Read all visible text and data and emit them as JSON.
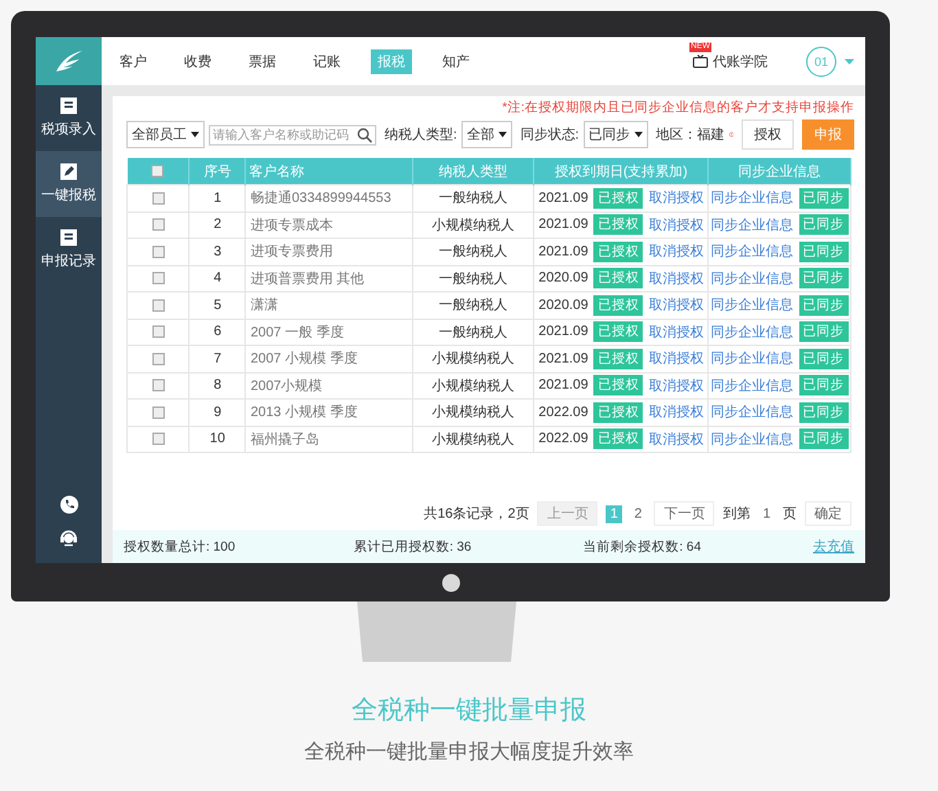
{
  "nav": {
    "tabs": [
      {
        "label": "客户",
        "selected": false
      },
      {
        "label": "收费",
        "selected": false
      },
      {
        "label": "票据",
        "selected": false
      },
      {
        "label": "记账",
        "selected": false
      },
      {
        "label": "报税",
        "selected": true
      },
      {
        "label": "知产",
        "selected": false
      }
    ],
    "academy": {
      "badge": "NEW",
      "label": "代账学院"
    },
    "user": "01"
  },
  "sidebar": {
    "items": [
      {
        "label": "税项录入",
        "selected": false
      },
      {
        "label": "一键报税",
        "selected": true
      },
      {
        "label": "申报记录",
        "selected": false
      }
    ]
  },
  "notice": "*注:在授权期限内且已同步企业信息的客户才支持申报操作",
  "filters": {
    "staff": "全部员工",
    "search": {
      "placeholder": "请输入客户名称或助记码"
    },
    "taxpayer_type": {
      "label": "纳税人类型:",
      "value": "全部"
    },
    "sync_status": {
      "label": "同步状态:",
      "value": "已同步"
    },
    "region": {
      "label": "地区：",
      "value": "福建"
    },
    "buttons": [
      {
        "label": "授权",
        "kind": "default"
      },
      {
        "label": "申报",
        "kind": "primary"
      }
    ]
  },
  "table": {
    "header_checked": false,
    "columns": [
      "序号",
      "客户名称",
      "纳税人类型",
      "授权到期日(支持累加)",
      "同步企业信息"
    ],
    "rows": [
      {
        "checked": false,
        "index": "1",
        "name": "畅捷通0334899944553",
        "type": "一般纳税人",
        "expiry": "2021.09",
        "auth_badge": "已授权",
        "cancel": "取消授权",
        "sync_link": "同步企业信息",
        "sync_badge": "已同步"
      },
      {
        "checked": false,
        "index": "2",
        "name": "进项专票成本",
        "type": "小规模纳税人",
        "expiry": "2021.09",
        "auth_badge": "已授权",
        "cancel": "取消授权",
        "sync_link": "同步企业信息",
        "sync_badge": "已同步"
      },
      {
        "checked": false,
        "index": "3",
        "name": "进项专票费用",
        "type": "一般纳税人",
        "expiry": "2021.09",
        "auth_badge": "已授权",
        "cancel": "取消授权",
        "sync_link": "同步企业信息",
        "sync_badge": "已同步"
      },
      {
        "checked": false,
        "index": "4",
        "name": "进项普票费用 其他",
        "type": "一般纳税人",
        "expiry": "2020.09",
        "auth_badge": "已授权",
        "cancel": "取消授权",
        "sync_link": "同步企业信息",
        "sync_badge": "已同步"
      },
      {
        "checked": false,
        "index": "5",
        "name": "潇潇",
        "type": "一般纳税人",
        "expiry": "2020.09",
        "auth_badge": "已授权",
        "cancel": "取消授权",
        "sync_link": "同步企业信息",
        "sync_badge": "已同步"
      },
      {
        "checked": false,
        "index": "6",
        "name": "2007 一般 季度",
        "type": "一般纳税人",
        "expiry": "2021.09",
        "auth_badge": "已授权",
        "cancel": "取消授权",
        "sync_link": "同步企业信息",
        "sync_badge": "已同步"
      },
      {
        "checked": false,
        "index": "7",
        "name": "2007 小规模 季度",
        "type": "小规模纳税人",
        "expiry": "2021.09",
        "auth_badge": "已授权",
        "cancel": "取消授权",
        "sync_link": "同步企业信息",
        "sync_badge": "已同步"
      },
      {
        "checked": false,
        "index": "8",
        "name": "2007小规模",
        "type": "小规模纳税人",
        "expiry": "2021.09",
        "auth_badge": "已授权",
        "cancel": "取消授权",
        "sync_link": "同步企业信息",
        "sync_badge": "已同步"
      },
      {
        "checked": false,
        "index": "9",
        "name": "2013 小规模 季度",
        "type": "小规模纳税人",
        "expiry": "2022.09",
        "auth_badge": "已授权",
        "cancel": "取消授权",
        "sync_link": "同步企业信息",
        "sync_badge": "已同步"
      },
      {
        "checked": false,
        "index": "10",
        "name": "福州撬子岛",
        "type": "小规模纳税人",
        "expiry": "2022.09",
        "auth_badge": "已授权",
        "cancel": "取消授权",
        "sync_link": "同步企业信息",
        "sync_badge": "已同步"
      }
    ]
  },
  "pagination": {
    "summary": "共16条记录，2页",
    "prev": {
      "label": "上一页",
      "disabled": true
    },
    "pages": [
      {
        "label": "1",
        "selected": true
      },
      {
        "label": "2",
        "selected": false
      }
    ],
    "next": "下一页",
    "goto_label": "到第",
    "page_input": "1",
    "page_unit": "页",
    "confirm": "确定"
  },
  "stats": {
    "total": "授权数量总计: 100",
    "used": "累计已用授权数: 36",
    "remaining": "当前剩余授权数: 64",
    "recharge": "去充值"
  },
  "caption": {
    "title": "全税种一键批量申报",
    "subtitle": "全税种一键批量申报大幅度提升效率"
  }
}
